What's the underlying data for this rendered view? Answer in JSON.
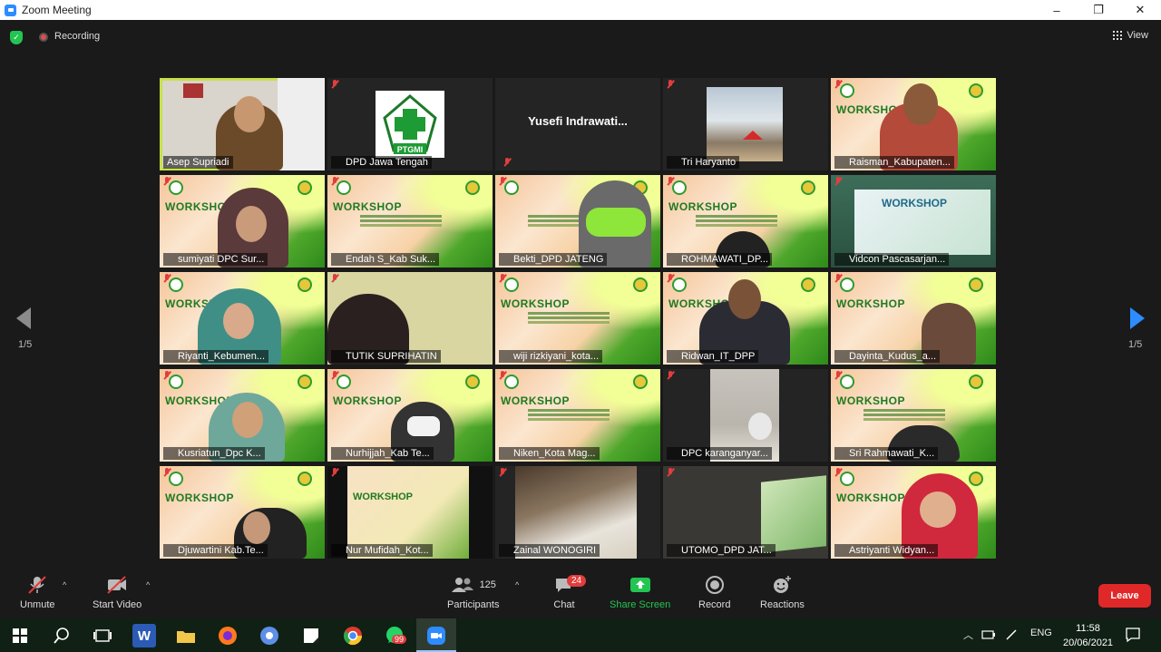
{
  "window": {
    "title": "Zoom Meeting",
    "minimize": "–",
    "maximize": "❐",
    "close": "✕"
  },
  "topbar": {
    "recording": "Recording",
    "view": "View"
  },
  "gallery": {
    "page_left": "1/5",
    "page_right": "1/5",
    "tiles": [
      {
        "name": "Asep Supriadi",
        "muted": false
      },
      {
        "name": "DPD Jawa Tengah",
        "muted": true
      },
      {
        "name": "",
        "muted": true,
        "big_name": "Yusefi Indrawati..."
      },
      {
        "name": "Tri Haryanto",
        "muted": true
      },
      {
        "name": "Raisman_Kabupaten...",
        "muted": true
      },
      {
        "name": "sumiyati DPC Sur...",
        "muted": true
      },
      {
        "name": "Endah S_Kab Suk...",
        "muted": true
      },
      {
        "name": "Bekti_DPD JATENG",
        "muted": true
      },
      {
        "name": "ROHMAWATI_DP...",
        "muted": true
      },
      {
        "name": "Vidcon Pascasarjan...",
        "muted": true
      },
      {
        "name": "Riyanti_Kebumen...",
        "muted": true
      },
      {
        "name": "TUTIK SUPRIHATIN",
        "muted": true
      },
      {
        "name": "wiji rizkiyani_kota...",
        "muted": true
      },
      {
        "name": "Ridwan_IT_DPP",
        "muted": true
      },
      {
        "name": "Dayinta_Kudus_a...",
        "muted": true
      },
      {
        "name": "Kusriatun_Dpc K...",
        "muted": true
      },
      {
        "name": "Nurhijjah_Kab Te...",
        "muted": true
      },
      {
        "name": "Niken_Kota Mag...",
        "muted": true
      },
      {
        "name": "DPC karanganyar...",
        "muted": true
      },
      {
        "name": "Sri Rahmawati_K...",
        "muted": true
      },
      {
        "name": "Djuwartini Kab.Te...",
        "muted": true
      },
      {
        "name": "Nur Mufidah_Kot...",
        "muted": true
      },
      {
        "name": "Zainal WONOGIRI",
        "muted": true
      },
      {
        "name": "UTOMO_DPD JAT...",
        "muted": true
      },
      {
        "name": "Astriyanti Widyan...",
        "muted": true
      }
    ],
    "banner_text": "WORKSHOP",
    "ptgmi_text": "PTGMI"
  },
  "toolbar": {
    "unmute": "Unmute",
    "start_video": "Start Video",
    "participants": "Participants",
    "participants_count": "125",
    "chat": "Chat",
    "chat_badge": "24",
    "share_screen": "Share Screen",
    "record": "Record",
    "reactions": "Reactions",
    "leave": "Leave",
    "caret": "^"
  },
  "taskbar": {
    "lang": "ENG",
    "time": "11:58",
    "date": "20/06/2021",
    "whatsapp_badge": "99",
    "word_label": "W"
  },
  "colors": {
    "accent": "#2d8cff",
    "share": "#23c552",
    "leave": "#e02828",
    "active_border": "#c6e04a"
  }
}
